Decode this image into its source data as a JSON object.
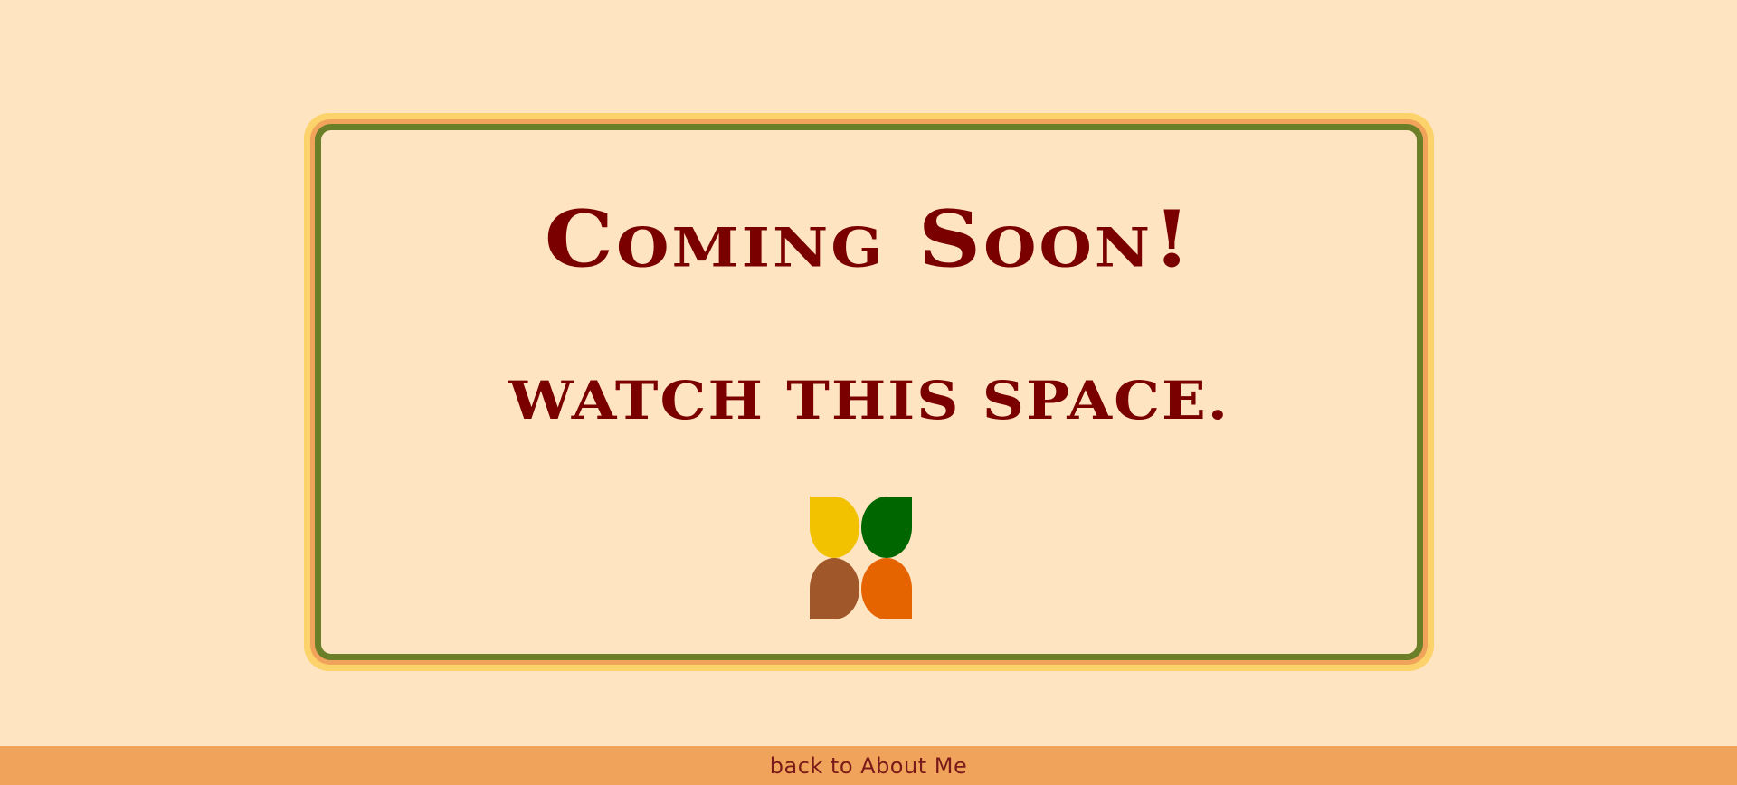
{
  "main": {
    "headline": "Coming Soon!",
    "subline": "watch this space.",
    "logo": {
      "icon": "four-leaf-logo-icon",
      "colors": {
        "top_left": "#f2c200",
        "top_right": "#006600",
        "bottom_left": "#a0582a",
        "bottom_right": "#e66400"
      }
    }
  },
  "footer": {
    "link_label": "back to About Me"
  },
  "colors": {
    "page_background": "#ffe4c2",
    "text_accent": "#7a0000",
    "frame_outer": "#fcd36b",
    "frame_mid": "#f0a35a",
    "frame_inner": "#6b7f28",
    "footer_background": "#f0a35a"
  }
}
